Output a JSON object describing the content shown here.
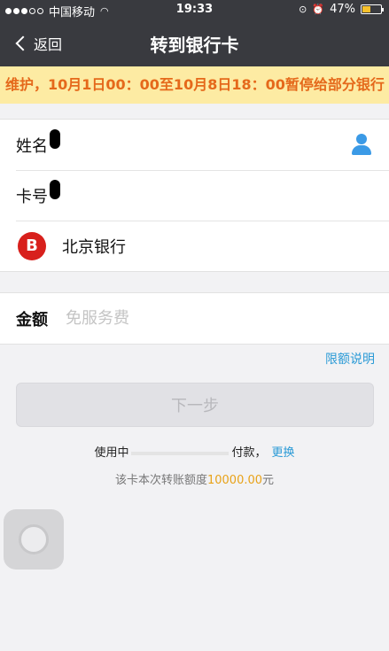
{
  "status_bar": {
    "carrier": "中国移动",
    "time": "19:33",
    "battery_percent": "47%",
    "battery_level": 0.47
  },
  "nav": {
    "back_label": "返回",
    "title": "转到银行卡"
  },
  "notice": {
    "text": "维护，10月1日00：00至10月8日18：00暂停给部分银行"
  },
  "form": {
    "name_label": "姓名",
    "card_label": "卡号",
    "bank_name": "北京银行",
    "bank_logo_glyph": "B",
    "amount_label": "金额",
    "amount_placeholder": "免服务费"
  },
  "limit_link": "限额说明",
  "next_button": "下一步",
  "payment": {
    "prefix": "使用中",
    "suffix": "付款，",
    "change_label": "更换"
  },
  "limit_info": {
    "prefix": "该卡本次转账额度",
    "amount": "10000.00",
    "suffix": "元"
  },
  "colors": {
    "nav_bg": "#393a3f",
    "notice_bg": "#fdeba3",
    "notice_text": "#e5691b",
    "link": "#2a9ad6",
    "bank_red": "#d8201c",
    "limit_amount": "#e8a218"
  }
}
